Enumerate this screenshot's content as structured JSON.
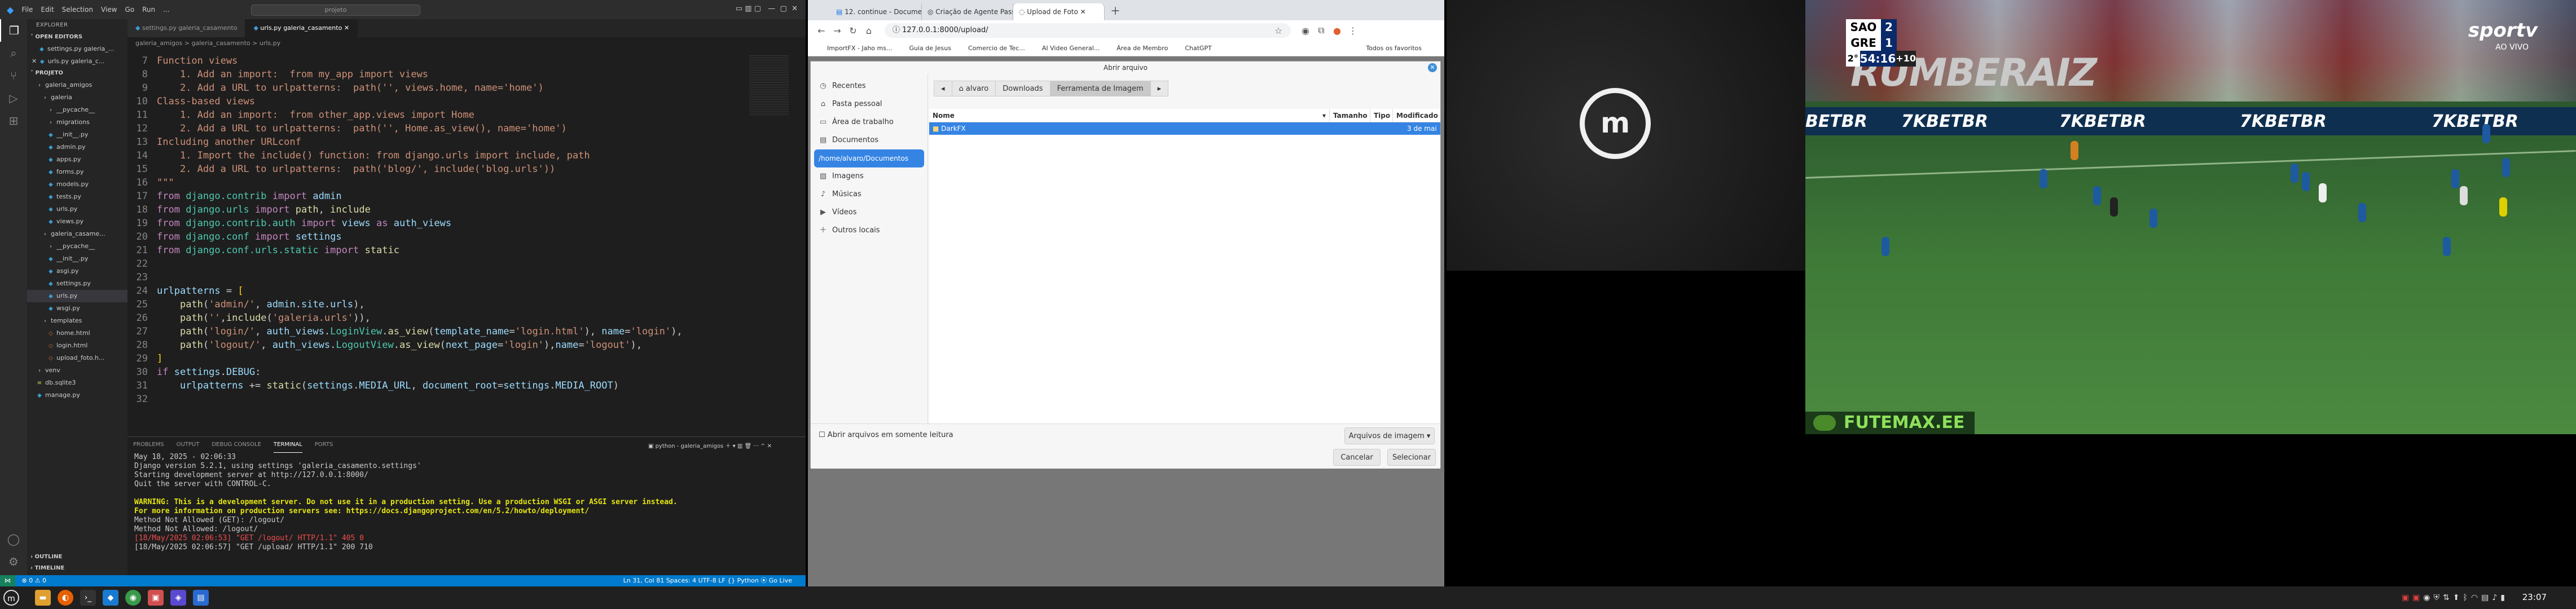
{
  "vscode": {
    "menu": [
      "File",
      "Edit",
      "Selection",
      "View",
      "Go",
      "Run",
      "..."
    ],
    "search_placeholder": "projeto",
    "explorer_title": "EXPLORER",
    "open_editors_title": "OPEN EDITORS",
    "open_editors": [
      "settings.py galeria_...",
      "urls.py galeria_c..."
    ],
    "project_title": "PROJETO",
    "tree": [
      {
        "label": "galeria_amigos",
        "indent": 1,
        "type": "folder"
      },
      {
        "label": "galeria",
        "indent": 2,
        "type": "folder"
      },
      {
        "label": "__pycache__",
        "indent": 3,
        "type": "folder"
      },
      {
        "label": "migrations",
        "indent": 3,
        "type": "folder"
      },
      {
        "label": "__init__.py",
        "indent": 3,
        "type": "py"
      },
      {
        "label": "admin.py",
        "indent": 3,
        "type": "py"
      },
      {
        "label": "apps.py",
        "indent": 3,
        "type": "py"
      },
      {
        "label": "forms.py",
        "indent": 3,
        "type": "py"
      },
      {
        "label": "models.py",
        "indent": 3,
        "type": "py"
      },
      {
        "label": "tests.py",
        "indent": 3,
        "type": "py"
      },
      {
        "label": "urls.py",
        "indent": 3,
        "type": "py"
      },
      {
        "label": "views.py",
        "indent": 3,
        "type": "py"
      },
      {
        "label": "galeria_casame...",
        "indent": 2,
        "type": "folder"
      },
      {
        "label": "__pycache__",
        "indent": 3,
        "type": "folder"
      },
      {
        "label": "__init__.py",
        "indent": 3,
        "type": "py"
      },
      {
        "label": "asgi.py",
        "indent": 3,
        "type": "py"
      },
      {
        "label": "settings.py",
        "indent": 3,
        "type": "py"
      },
      {
        "label": "urls.py",
        "indent": 3,
        "type": "py",
        "selected": true
      },
      {
        "label": "wsgi.py",
        "indent": 3,
        "type": "py"
      },
      {
        "label": "templates",
        "indent": 2,
        "type": "folder"
      },
      {
        "label": "home.html",
        "indent": 3,
        "type": "html"
      },
      {
        "label": "login.html",
        "indent": 3,
        "type": "html"
      },
      {
        "label": "upload_foto.h...",
        "indent": 3,
        "type": "html"
      },
      {
        "label": "venv",
        "indent": 1,
        "type": "folder"
      },
      {
        "label": "db.sqlite3",
        "indent": 1,
        "type": "db"
      },
      {
        "label": "manage.py",
        "indent": 1,
        "type": "py"
      }
    ],
    "outline_title": "OUTLINE",
    "timeline_title": "TIMELINE",
    "tabs": [
      "settings.py galeria_casamento",
      "urls.py galeria_casamento"
    ],
    "breadcrumb": "galeria_amigos > galeria_casamento > urls.py",
    "terminal_tabs": [
      "PROBLEMS",
      "OUTPUT",
      "DEBUG CONSOLE",
      "TERMINAL",
      "PORTS"
    ],
    "terminal_label": "python - galeria_amigos",
    "terminal_lines": [
      "May 18, 2025 - 02:06:33",
      "Django version 5.2.1, using settings 'galeria_casamento.settings'",
      "Starting development server at http://127.0.0.1:8000/",
      "Quit the server with CONTROL-C.",
      "",
      "WARNING: This is a development server. Do not use it in a production setting. Use a production WSGI or ASGI server instead.",
      "For more information on production servers see: https://docs.djangoproject.com/en/5.2/howto/deployment/",
      "Method Not Allowed (GET): /logout/",
      "Method Not Allowed: /logout/",
      "[18/May/2025 02:06:53] \"GET /logout/ HTTP/1.1\" 405 0",
      "[18/May/2025 02:06:57] \"GET /upload/ HTTP/1.1\" 200 710"
    ],
    "status_left": "⊗ 0 ⚠ 0",
    "status_right": "Ln 31, Col 81   Spaces: 4   UTF-8   LF   {} Python   ⦿ Go Live"
  },
  "browser": {
    "tabs": [
      "12. continue - Documento...",
      "Criação de Agente Passo a...",
      "Upload de Foto"
    ],
    "url": "127.0.0.1:8000/upload/",
    "bookmarks": [
      "ImportFX - Jaho ms...",
      "Guia de Jesus",
      "Comercio de Tec...",
      "AI Video General...",
      "Área de Membro",
      "ChatGPT",
      "Todos os favoritos"
    ]
  },
  "dialog": {
    "title": "Abrir arquivo",
    "places": [
      "Recentes",
      "Pasta pessoal",
      "Área de trabalho",
      "Documentos",
      "/home/alvaro/Documentos",
      "Imagens",
      "Músicas",
      "Vídeos",
      "Outros locais"
    ],
    "path": [
      "alvaro",
      "Downloads",
      "Ferramenta de Imagem"
    ],
    "columns": [
      "Nome",
      "Tamanho",
      "Tipo",
      "Modificado"
    ],
    "file": {
      "name": "DarkFX",
      "modified": "3 de mai"
    },
    "readonly_label": "Abrir arquivos em somente leitura",
    "filter": "Arquivos de imagem",
    "cancel": "Cancelar",
    "select": "Selecionar"
  },
  "video": {
    "team1": "SAO",
    "score1": "2",
    "team2": "GRE",
    "score2": "1",
    "half": "2°",
    "time": "54:16",
    "added": "+10",
    "broadcaster": "sportv",
    "live": "AO VIVO",
    "banner": "RUMBERAIZ",
    "ads": [
      "BETBR",
      "7KBETBR",
      "7KBETBR",
      "7KBETBR",
      "7KBETBR"
    ],
    "watermark": "FUTEMAX.EE"
  },
  "taskbar": {
    "clock": "23:07"
  }
}
